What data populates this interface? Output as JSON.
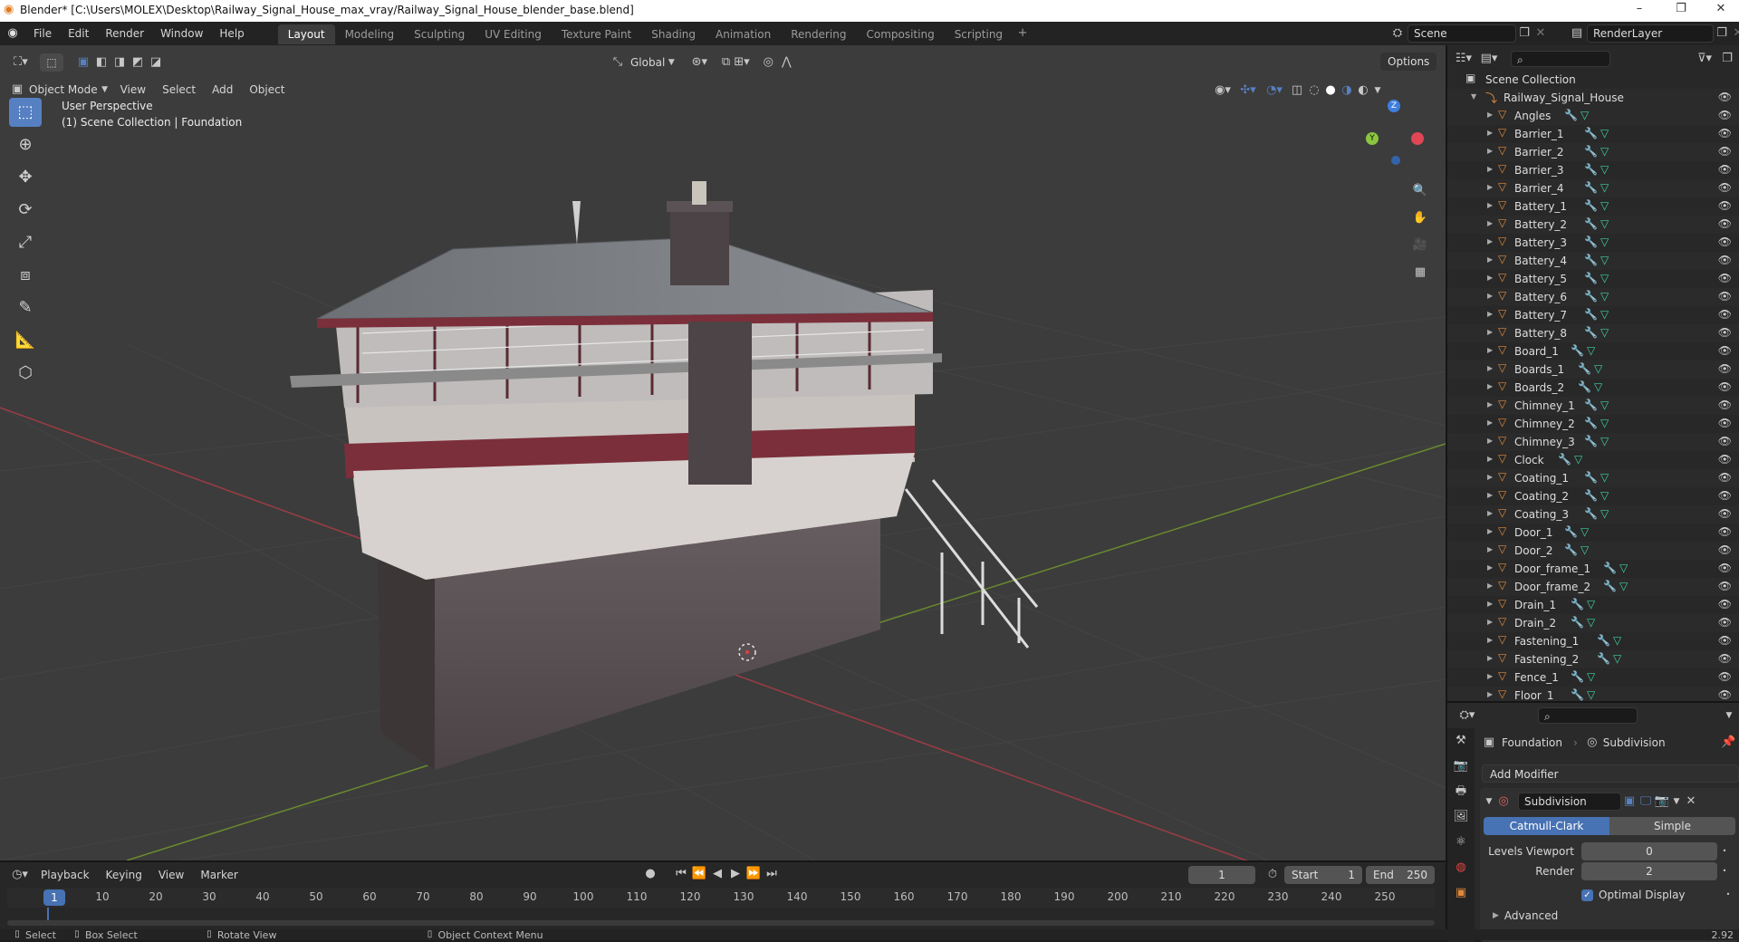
{
  "window": {
    "title": "Blender* [C:\\Users\\MOLEX\\Desktop\\Railway_Signal_House_max_vray/Railway_Signal_House_blender_base.blend]"
  },
  "menus": [
    "File",
    "Edit",
    "Render",
    "Window",
    "Help"
  ],
  "workspaces": [
    {
      "label": "Layout",
      "active": true
    },
    {
      "label": "Modeling"
    },
    {
      "label": "Sculpting"
    },
    {
      "label": "UV Editing"
    },
    {
      "label": "Texture Paint"
    },
    {
      "label": "Shading"
    },
    {
      "label": "Animation"
    },
    {
      "label": "Rendering"
    },
    {
      "label": "Compositing"
    },
    {
      "label": "Scripting"
    }
  ],
  "scene": {
    "name": "Scene",
    "render_layer": "RenderLayer"
  },
  "viewport": {
    "mode": "Object Mode",
    "menus": [
      "View",
      "Select",
      "Add",
      "Object"
    ],
    "orientation": "Global",
    "options_label": "Options",
    "overlay_title": "User Perspective",
    "overlay_subtitle": "(1) Scene Collection | Foundation",
    "gizmo": {
      "z": "Z",
      "y": "Y"
    }
  },
  "outliner": {
    "root": "Scene Collection",
    "collection": "Railway_Signal_House",
    "items": [
      "Angles",
      "Barrier_1",
      "Barrier_2",
      "Barrier_3",
      "Barrier_4",
      "Battery_1",
      "Battery_2",
      "Battery_3",
      "Battery_4",
      "Battery_5",
      "Battery_6",
      "Battery_7",
      "Battery_8",
      "Board_1",
      "Boards_1",
      "Boards_2",
      "Chimney_1",
      "Chimney_2",
      "Chimney_3",
      "Clock",
      "Coating_1",
      "Coating_2",
      "Coating_3",
      "Door_1",
      "Door_2",
      "Door_frame_1",
      "Door_frame_2",
      "Drain_1",
      "Drain_2",
      "Fastening_1",
      "Fastening_2",
      "Fence_1",
      "Floor_1"
    ]
  },
  "properties": {
    "breadcrumb_object": "Foundation",
    "breadcrumb_modifier": "Subdivision",
    "add_modifier": "Add Modifier",
    "modifier_name": "Subdivision",
    "tab_catmull": "Catmull-Clark",
    "tab_simple": "Simple",
    "levels_viewport_label": "Levels Viewport",
    "levels_viewport_value": "0",
    "render_label": "Render",
    "render_value": "2",
    "optimal_display": "Optimal Display",
    "advanced": "Advanced"
  },
  "timeline": {
    "menus": [
      "Playback",
      "Keying",
      "View",
      "Marker"
    ],
    "current_frame": "1",
    "start_label": "Start",
    "start_value": "1",
    "end_label": "End",
    "end_value": "250",
    "ticks": [
      "10",
      "20",
      "30",
      "40",
      "50",
      "60",
      "70",
      "80",
      "90",
      "100",
      "110",
      "120",
      "130",
      "140",
      "150",
      "160",
      "170",
      "180",
      "190",
      "200",
      "210",
      "220",
      "230",
      "240",
      "250"
    ],
    "playhead": "1"
  },
  "status": {
    "select": "Select",
    "box_select": "Box Select",
    "rotate_view": "Rotate View",
    "context_menu": "Object Context Menu",
    "version": "2.92"
  },
  "colors": {
    "accent": "#5680c2",
    "mesh": "#3fd0a3",
    "modifier": "#6c9be6",
    "object": "#e08a3c"
  }
}
